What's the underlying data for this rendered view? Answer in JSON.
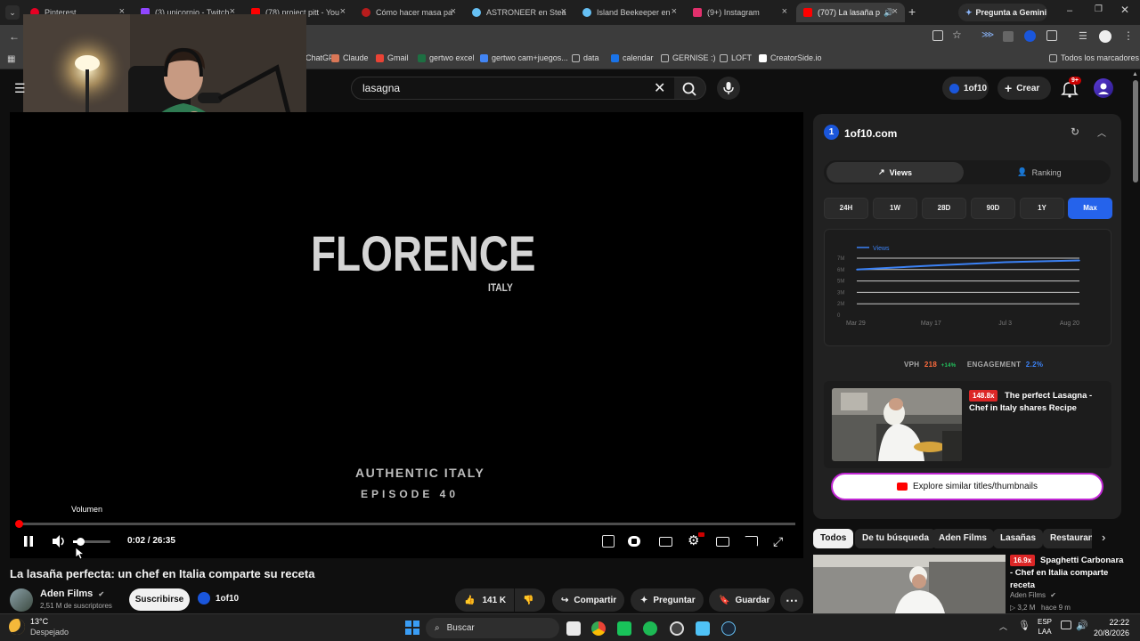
{
  "tabs": [
    {
      "label": "Pinterest",
      "color": "#e60023"
    },
    {
      "label": "(3) unicornio - Twitch",
      "color": "#9146ff"
    },
    {
      "label": "(78) project pitt - You",
      "color": "#ff0000"
    },
    {
      "label": "Cómo hacer masa pa",
      "color": "#b71c1c"
    },
    {
      "label": "ASTRONEER en Stea",
      "color": "#1b2838"
    },
    {
      "label": "Island Beekeeper en",
      "color": "#1b2838"
    },
    {
      "label": "(9+) Instagram",
      "color": "#e1306c"
    },
    {
      "label": "(707) La lasaña p",
      "color": "#ff0000"
    }
  ],
  "gemini_button": "Pregunta a Gemini",
  "bookmarks": [
    {
      "label": "ChatGPT",
      "color": "#10a37f"
    },
    {
      "label": "Claude",
      "color": "#d97757"
    },
    {
      "label": "Gmail",
      "color": "#ea4335"
    },
    {
      "label": "gertwo excel",
      "color": "#1d6f42"
    },
    {
      "label": "gertwo cam+juegos...",
      "color": "#4285f4"
    },
    {
      "label": "data",
      "color": "#888888"
    },
    {
      "label": "calendar",
      "color": "#1a73e8"
    },
    {
      "label": "GERNISE :)",
      "color": "#888888"
    },
    {
      "label": "LOFT",
      "color": "#888888"
    },
    {
      "label": "CreatorSide.io",
      "color": "#ffffff"
    }
  ],
  "all_bookmarks": "Todos los marcadores",
  "header": {
    "search_value": "lasagna",
    "oneof10": "1of10",
    "create": "Crear",
    "notif_badge": "9+"
  },
  "player": {
    "title_big": "FLORENCE",
    "subtitle": "ITALY",
    "footer_line1": "AUTHENTIC ITALY",
    "footer_line2": "EPISODE 40",
    "tooltip": "Volumen",
    "time": "0:02 / 26:35",
    "progress": 0.0013,
    "volume": 0.2
  },
  "video": {
    "title": "La lasaña perfecta: un chef en Italia comparte su receta",
    "channel": "Aden Films",
    "subscribers": "2,51 M de suscriptores",
    "subscribe": "Suscribirse",
    "oneof10": "1of10",
    "likes": "141 K",
    "share": "Compartir",
    "ask": "Preguntar",
    "save": "Guardar"
  },
  "panel": {
    "site": "1of10.com",
    "tab_views": "Views",
    "tab_ranking": "Ranking",
    "ranges": [
      "24H",
      "1W",
      "28D",
      "90D",
      "1Y",
      "Max"
    ],
    "active_range": "Max",
    "legend": "Views",
    "vph_label": "VPH",
    "vph_value": "218",
    "vph_delta": "+14%",
    "engagement_label": "ENGAGEMENT",
    "engagement_value": "2.2%",
    "card_multiplier": "148.8x",
    "card_title": "The perfect Lasagna - Chef in Italy shares Recipe",
    "explore": "Explore similar titles/thumbnails"
  },
  "chart_data": {
    "type": "line",
    "x": [
      "Mar 29",
      "May 17",
      "Jul 3",
      "Aug 20"
    ],
    "yticks": [
      "0",
      "2M",
      "3M",
      "5M",
      "6M",
      "7M"
    ],
    "series": [
      {
        "name": "Views",
        "values": [
          6.0,
          6.35,
          6.65,
          6.8
        ]
      }
    ],
    "ylim": [
      0,
      7
    ],
    "color": "#3b82f6"
  },
  "chips": [
    "Todos",
    "De tu búsqueda",
    "Aden Films",
    "Lasañas",
    "Restaurantes"
  ],
  "related": {
    "multiplier": "16.9x",
    "title": "Spaghetti Carbonara - Chef en Italia comparte receta",
    "channel": "Aden Films",
    "meta": "▷ 3,2 M   hace 9 m"
  },
  "taskbar": {
    "weather_temp": "13°C",
    "weather_desc": "Despejado",
    "search": "Buscar",
    "lang1": "ESP",
    "lang2": "LAA",
    "clock_time": "22:22",
    "clock_date": "20/8/2026"
  }
}
